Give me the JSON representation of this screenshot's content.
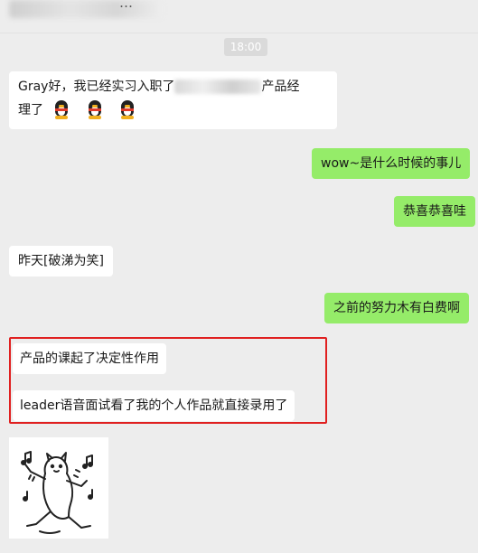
{
  "header": {
    "title": "…"
  },
  "time_label": "18:00",
  "messages": [
    {
      "side": "left",
      "text_before": "Gray好，我已经实习入职了",
      "text_after": "产品经",
      "line2": "理了"
    },
    {
      "side": "right",
      "text": "wow~是什么时候的事儿"
    },
    {
      "side": "right",
      "text": "恭喜恭喜哇"
    },
    {
      "side": "left",
      "text": "昨天[破涕为笑]"
    },
    {
      "side": "right",
      "text": "之前的努力木有白费啊"
    },
    {
      "side": "left",
      "text": "产品的课起了决定性作用"
    },
    {
      "side": "left",
      "text": "leader语音面试看了我的个人作品就直接录用了"
    }
  ],
  "colors": {
    "background": "#ededed",
    "left_bubble": "#ffffff",
    "right_bubble": "#95ec69",
    "highlight": "#e02020"
  },
  "icons": [
    "qq-penguin-emoji",
    "dancing-cat-sticker"
  ]
}
